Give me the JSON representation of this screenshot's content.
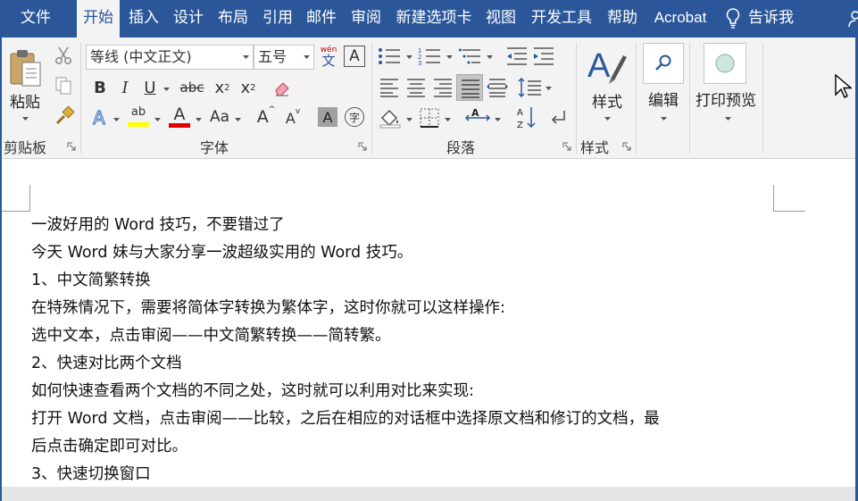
{
  "tabs": [
    {
      "label": "文件",
      "active": false
    },
    {
      "label": "开始",
      "active": true
    },
    {
      "label": "插入",
      "active": false
    },
    {
      "label": "设计",
      "active": false
    },
    {
      "label": "布局",
      "active": false
    },
    {
      "label": "引用",
      "active": false
    },
    {
      "label": "邮件",
      "active": false
    },
    {
      "label": "审阅",
      "active": false
    },
    {
      "label": "新建选项卡",
      "active": false
    },
    {
      "label": "视图",
      "active": false
    },
    {
      "label": "开发工具",
      "active": false
    },
    {
      "label": "帮助",
      "active": false
    },
    {
      "label": "Acrobat",
      "active": false
    }
  ],
  "tell_me": {
    "label": "告诉我",
    "icon": "lightbulb-icon"
  },
  "ribbon": {
    "clipboard": {
      "paste_label": "粘贴",
      "group_label": "剪贴板"
    },
    "font": {
      "font_name": "等线 (中文正文)",
      "font_size": "五号",
      "phonetic_top": "wén",
      "phonetic_bottom": "文",
      "char_border": "A",
      "bold": "B",
      "italic": "I",
      "underline": "U",
      "strike": "abc",
      "subscript": "x",
      "sub_mark": "2",
      "superscript": "x",
      "sup_mark": "2",
      "change_case": "Aa",
      "grow": "A",
      "shrink": "A",
      "shade_letter": "A",
      "enclose_char": "字",
      "font_color_letter": "A",
      "highlight_letters": "ab",
      "text_effects_letter": "A",
      "group_label": "字体",
      "highlight_color": "#ffff00",
      "font_color": "#e00000"
    },
    "paragraph": {
      "group_label": "段落"
    },
    "styles": {
      "styles_label": "样式",
      "group_label": "样式"
    },
    "editing": {
      "label": "编辑"
    },
    "print_preview": {
      "label": "打印预览"
    }
  },
  "accent_color": "#2b579a",
  "document": {
    "lines": [
      "一波好用的 Word 技巧，不要错过了",
      "今天 Word 妹与大家分享一波超级实用的 Word 技巧。",
      "1、中文简繁转换",
      "在特殊情况下，需要将简体字转换为繁体字，这时你就可以这样操作:",
      "选中文本，点击审阅——中文简繁转换——简转繁。",
      "2、快速对比两个文档",
      "如何快速查看两个文档的不同之处，这时就可以利用对比来实现:",
      "打开 Word 文档，点击审阅——比较，之后在相应的对话框中选择原文档和修订的文档，最",
      "后点击确定即可对比。",
      "3、快速切换窗口"
    ]
  }
}
